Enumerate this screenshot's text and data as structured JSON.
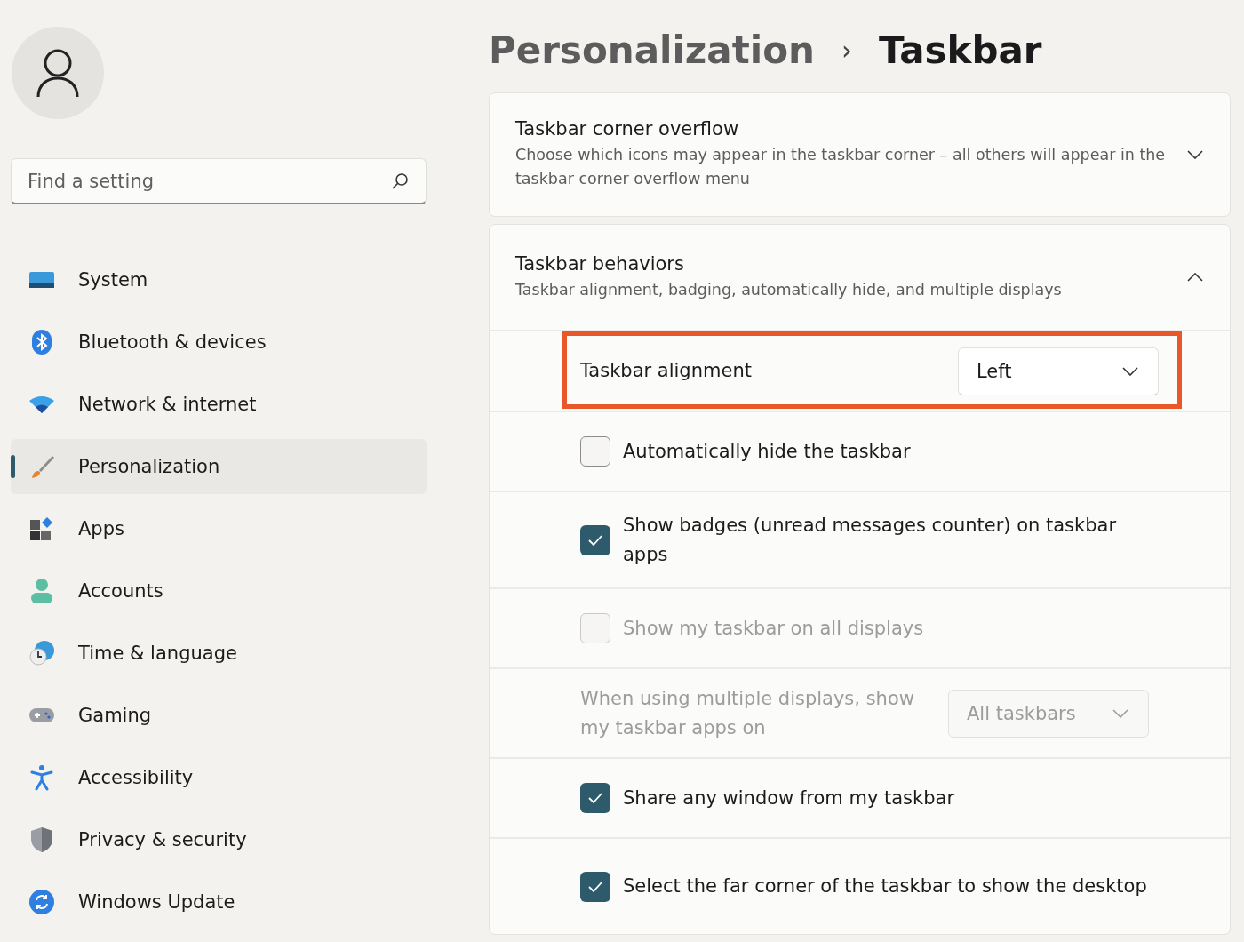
{
  "breadcrumb": {
    "parent": "Personalization",
    "separator": "›",
    "current": "Taskbar"
  },
  "search": {
    "placeholder": "Find a setting"
  },
  "sidebar": {
    "items": [
      {
        "label": "System",
        "selected": false
      },
      {
        "label": "Bluetooth & devices",
        "selected": false
      },
      {
        "label": "Network & internet",
        "selected": false
      },
      {
        "label": "Personalization",
        "selected": true
      },
      {
        "label": "Apps",
        "selected": false
      },
      {
        "label": "Accounts",
        "selected": false
      },
      {
        "label": "Time & language",
        "selected": false
      },
      {
        "label": "Gaming",
        "selected": false
      },
      {
        "label": "Accessibility",
        "selected": false
      },
      {
        "label": "Privacy & security",
        "selected": false
      },
      {
        "label": "Windows Update",
        "selected": false
      }
    ]
  },
  "sections": [
    {
      "title": "Taskbar corner overflow",
      "description": "Choose which icons may appear in the taskbar corner – all others will appear in the taskbar corner overflow menu",
      "expanded": false
    },
    {
      "title": "Taskbar behaviors",
      "description": "Taskbar alignment, badging, automatically hide, and multiple displays",
      "expanded": true,
      "rows": [
        {
          "kind": "dropdown",
          "label": "Taskbar alignment",
          "value": "Left",
          "disabled": false,
          "highlighted": true
        },
        {
          "kind": "checkbox",
          "label": "Automatically hide the taskbar",
          "checked": false,
          "disabled": false
        },
        {
          "kind": "checkbox",
          "label": "Show badges (unread messages counter) on taskbar apps",
          "checked": true,
          "disabled": false
        },
        {
          "kind": "checkbox",
          "label": "Show my taskbar on all displays",
          "checked": false,
          "disabled": true
        },
        {
          "kind": "dropdown",
          "label": "When using multiple displays, show my taskbar apps on",
          "value": "All taskbars",
          "disabled": true,
          "highlighted": false
        },
        {
          "kind": "checkbox",
          "label": "Share any window from my taskbar",
          "checked": true,
          "disabled": false
        },
        {
          "kind": "checkbox",
          "label": "Select the far corner of the taskbar to show the desktop",
          "checked": true,
          "disabled": false
        }
      ]
    }
  ]
}
